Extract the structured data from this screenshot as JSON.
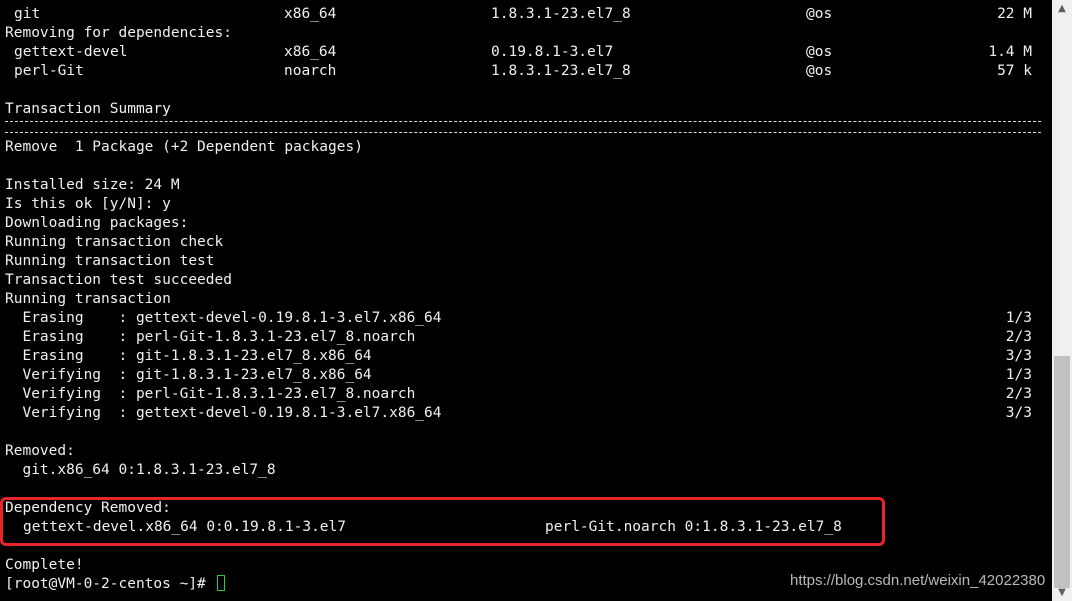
{
  "top_table": [
    {
      "name": "git",
      "arch": "x86_64",
      "version": "1.8.3.1-23.el7_8",
      "repo": "@os",
      "size": "22 M"
    }
  ],
  "removing_header": "Removing for dependencies:",
  "dep_table": [
    {
      "name": "gettext-devel",
      "arch": "x86_64",
      "version": "0.19.8.1-3.el7",
      "repo": "@os",
      "size": "1.4 M"
    },
    {
      "name": "perl-Git",
      "arch": "noarch",
      "version": "1.8.3.1-23.el7_8",
      "repo": "@os",
      "size": "57 k"
    }
  ],
  "summary_title": "Transaction Summary",
  "summary_remove": "Remove  1 Package (+2 Dependent packages)",
  "log_lines": [
    "Installed size: 24 M",
    "Is this ok [y/N]: y",
    "Downloading packages:",
    "Running transaction check",
    "Running transaction test",
    "Transaction test succeeded",
    "Running transaction"
  ],
  "transactions": [
    {
      "action": "  Erasing    : gettext-devel-0.19.8.1-3.el7.x86_64",
      "progress": "1/3"
    },
    {
      "action": "  Erasing    : perl-Git-1.8.3.1-23.el7_8.noarch",
      "progress": "2/3"
    },
    {
      "action": "  Erasing    : git-1.8.3.1-23.el7_8.x86_64",
      "progress": "3/3"
    },
    {
      "action": "  Verifying  : git-1.8.3.1-23.el7_8.x86_64",
      "progress": "1/3"
    },
    {
      "action": "  Verifying  : perl-Git-1.8.3.1-23.el7_8.noarch",
      "progress": "2/3"
    },
    {
      "action": "  Verifying  : gettext-devel-0.19.8.1-3.el7.x86_64",
      "progress": "3/3"
    }
  ],
  "removed_title": "Removed:",
  "removed_item": "  git.x86_64 0:1.8.3.1-23.el7_8",
  "dep_removed_title": "Dependency Removed:",
  "dep_removed_items": [
    "gettext-devel.x86_64 0:0.19.8.1-3.el7",
    "perl-Git.noarch 0:1.8.3.1-23.el7_8"
  ],
  "complete": "Complete!",
  "prompt": "[root@VM-0-2-centos ~]# ",
  "watermark": "https://blog.csdn.net/weixin_42022380",
  "colors": {
    "highlight_border": "#e8242a",
    "cursor": "#2ecc40"
  }
}
